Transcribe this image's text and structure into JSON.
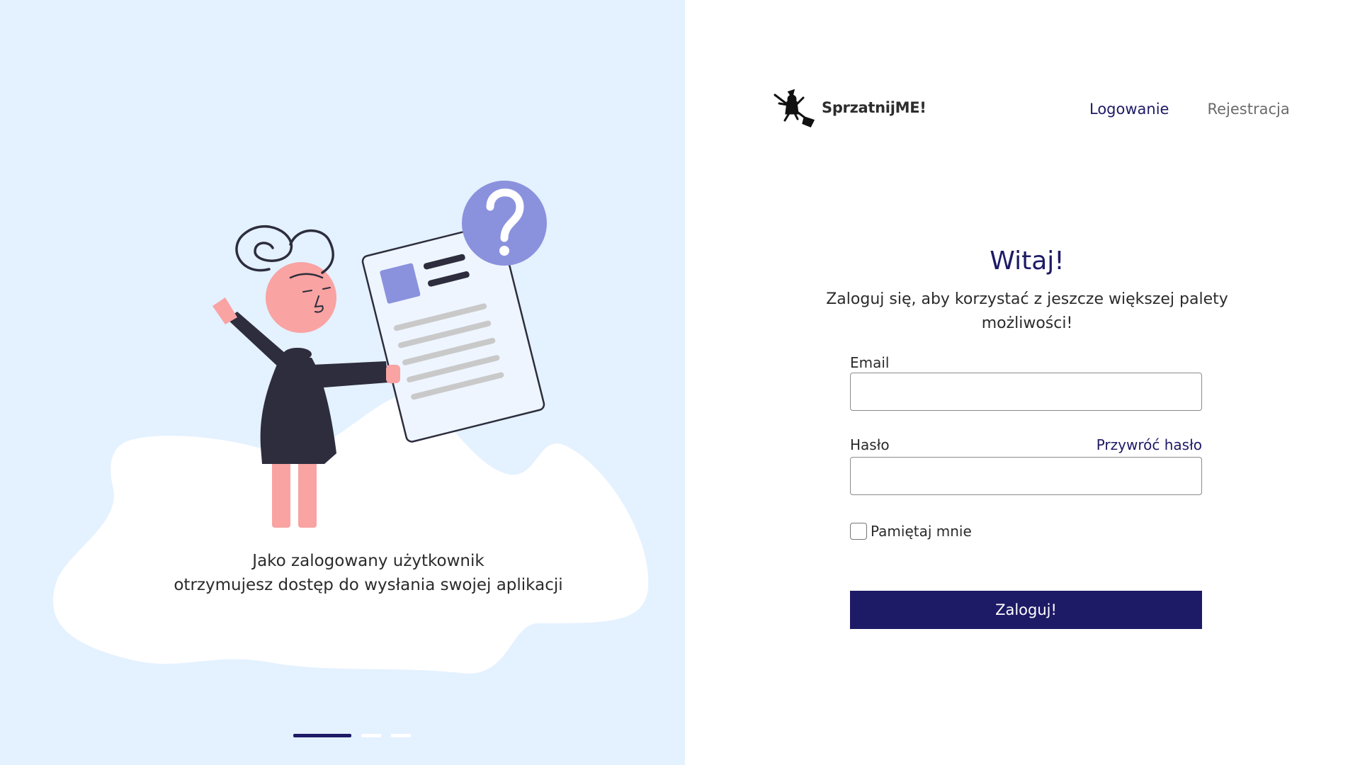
{
  "brand": {
    "name": "SprzatnijME!",
    "logo_icon": "witch-on-broom-icon"
  },
  "nav": {
    "login": "Logowanie",
    "register": "Rejestracja"
  },
  "left": {
    "caption_line1": "Jako zalogowany użytkownik",
    "caption_line2": "otrzymujesz dostęp do wysłania swojej aplikacji",
    "carousel": {
      "slides": 3,
      "active": 1
    }
  },
  "login": {
    "heading": "Witaj!",
    "subtitle": "Zaloguj się, aby korzystać z jeszcze większej palety możliwości!",
    "email_label": "Email",
    "email_value": "",
    "password_label": "Hasło",
    "password_value": "",
    "forgot_password": "Przywróć hasło",
    "remember_me": "Pamiętaj mnie",
    "remember_checked": false,
    "submit_label": "Zaloguj!"
  },
  "colors": {
    "accent": "#1d1a66",
    "left_bg": "#e4f1ff",
    "illustration_purple": "#8a92de",
    "illustration_pink": "#f9a3a2"
  }
}
